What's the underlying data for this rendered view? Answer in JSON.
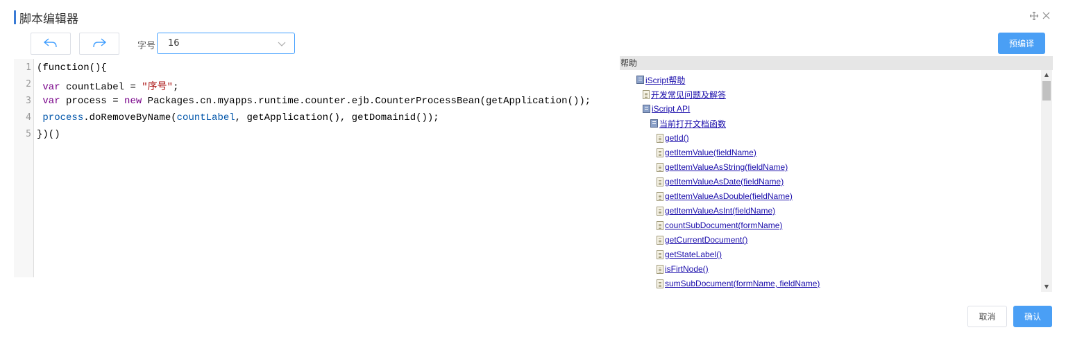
{
  "dialog": {
    "title": "脚本编辑器",
    "accent_color": "#3a7bd5",
    "move_icon": "move-icon",
    "close_icon": "close-icon"
  },
  "toolbar": {
    "undo_icon": "undo-icon",
    "redo_icon": "redo-icon",
    "font_size_label": "字号",
    "font_size_value": "16",
    "precompile_label": "预编译"
  },
  "editor": {
    "line_numbers": [
      "1",
      "2",
      "3",
      "4",
      "5"
    ],
    "lines": [
      [
        {
          "t": "(function(){",
          "c": ""
        }
      ],
      [
        {
          "t": " ",
          "c": ""
        },
        {
          "t": "var",
          "c": "kw"
        },
        {
          "t": " countLabel = ",
          "c": ""
        },
        {
          "t": "\"序号\"",
          "c": "str"
        },
        {
          "t": ";",
          "c": ""
        }
      ],
      [
        {
          "t": " ",
          "c": ""
        },
        {
          "t": "var",
          "c": "kw"
        },
        {
          "t": " process = ",
          "c": ""
        },
        {
          "t": "new",
          "c": "kw"
        },
        {
          "t": " Packages.cn.myapps.runtime.counter.ejb.CounterProcessBean(getApplication());",
          "c": ""
        }
      ],
      [
        {
          "t": " ",
          "c": ""
        },
        {
          "t": "process",
          "c": "vr"
        },
        {
          "t": ".doRemoveByName(",
          "c": ""
        },
        {
          "t": "countLabel",
          "c": "vr"
        },
        {
          "t": ", getApplication(), getDomainid());",
          "c": ""
        }
      ],
      [
        {
          "t": "})()",
          "c": ""
        }
      ]
    ]
  },
  "help": {
    "title": "帮助",
    "items": [
      {
        "label": "iScript帮助",
        "icon": "book"
      },
      {
        "label": "开发常见问题及解答",
        "icon": "page"
      },
      {
        "label": "iScript API",
        "icon": "book"
      },
      {
        "label": "当前打开文档函数",
        "icon": "book"
      },
      {
        "label": "getId()",
        "icon": "page"
      },
      {
        "label": "getItemValue(fieldName)",
        "icon": "page"
      },
      {
        "label": "getItemValueAsString(fieldName)",
        "icon": "page"
      },
      {
        "label": "getItemValueAsDate(fieldName)",
        "icon": "page"
      },
      {
        "label": "getItemValueAsDouble(fieldName)",
        "icon": "page"
      },
      {
        "label": "getItemValueAsInt(fieldName)",
        "icon": "page"
      },
      {
        "label": "countSubDocument(formName)",
        "icon": "page"
      },
      {
        "label": "getCurrentDocument()",
        "icon": "page"
      },
      {
        "label": "getStateLabel()",
        "icon": "page"
      },
      {
        "label": "isFirtNode()",
        "icon": "page"
      },
      {
        "label": "sumSubDocument(formName, fieldName)",
        "icon": "page"
      }
    ]
  },
  "footer": {
    "cancel_label": "取消",
    "confirm_label": "确认"
  },
  "colors": {
    "primary": "#4a9ff5",
    "link": "#1a0dab"
  }
}
